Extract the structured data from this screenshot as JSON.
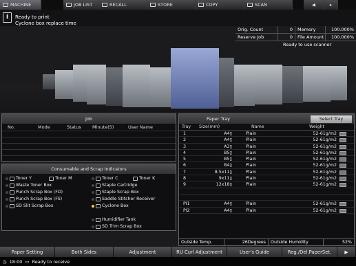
{
  "tabs": [
    {
      "label": "MACHINE",
      "icon": "machine-icon"
    },
    {
      "label": "JOB LIST",
      "icon": "list-icon"
    },
    {
      "label": "RECALL",
      "icon": "recall-icon"
    },
    {
      "label": "STORE",
      "icon": "store-icon"
    },
    {
      "label": "COPY",
      "icon": "copy-icon"
    },
    {
      "label": "SCAN",
      "icon": "scan-icon"
    }
  ],
  "message": {
    "line1": "Ready to print",
    "line2": "Cyclone box replace time"
  },
  "counters": {
    "orig_count_label": "Orig. Count",
    "orig_count_value": "0",
    "memory_label": "Memory",
    "memory_value": "100.000%",
    "reserve_job_label": "Reserve Job",
    "reserve_job_value": "0",
    "file_amount_label": "File Amount",
    "file_amount_value": "100.000%"
  },
  "ready_scanner": "Ready to use scanner",
  "job": {
    "title": "Job",
    "columns": [
      "No.",
      "Mode",
      "Status",
      "Minute(S)",
      "User Name"
    ]
  },
  "consumables": {
    "title": "Consumable and Scrap Indicators",
    "items": [
      {
        "label": "Toner Y"
      },
      {
        "label": "Toner M"
      },
      {
        "label": "Toner C"
      },
      {
        "label": "Toner K"
      },
      {
        "label": "Waste Toner Box"
      },
      {
        "label": "Staple Cartridge"
      },
      {
        "label": "Punch Scrap Box (FD)"
      },
      {
        "label": "Staple Scrap Box"
      },
      {
        "label": "Punch Scrap Box (FS)"
      },
      {
        "label": "Saddle Stitcher Receiver"
      },
      {
        "label": "SD Slit Scrap Box"
      },
      {
        "label": "Cyclone Box"
      },
      {
        "label": "Humidifier Tank"
      },
      {
        "label": "SD Trim Scrap Box"
      }
    ]
  },
  "tray": {
    "title": "Paper Tray",
    "select_label": "Select Tray",
    "columns": [
      "Tray",
      "Size(mm)",
      "Name",
      "Weight"
    ],
    "rows": [
      {
        "tray": "1",
        "size": "A4▯",
        "name": "Plain",
        "weight": "52-61g/m2"
      },
      {
        "tray": "2",
        "size": "A4▯",
        "name": "Plain",
        "weight": "52-61g/m2"
      },
      {
        "tray": "3",
        "size": "A3▯",
        "name": "Plain",
        "weight": "52-61g/m2"
      },
      {
        "tray": "4",
        "size": "B5▯",
        "name": "Plain",
        "weight": "52-61g/m2"
      },
      {
        "tray": "5",
        "size": "B5▯",
        "name": "Plain",
        "weight": "52-61g/m2"
      },
      {
        "tray": "6",
        "size": "B4▯",
        "name": "Plain",
        "weight": "52-61g/m2"
      },
      {
        "tray": "7",
        "size": "8.5x11▯",
        "name": "Plain",
        "weight": "52-61g/m2"
      },
      {
        "tray": "8",
        "size": "9x11▯",
        "name": "Plain",
        "weight": "52-61g/m2"
      },
      {
        "tray": "9",
        "size": "12x18▯",
        "name": "Plain",
        "weight": "52-61g/m2"
      },
      {
        "tray": "PI1",
        "size": "A4▯",
        "name": "Plain",
        "weight": "52-61g/m2"
      },
      {
        "tray": "PI2",
        "size": "A4▯",
        "name": "Plain",
        "weight": "52-61g/m2"
      }
    ],
    "outside_temp_label": "Outside Temp.",
    "outside_temp_value": "26Degrees",
    "outside_humidity_label": "Outside Humidity",
    "outside_humidity_value": "52%"
  },
  "buttons": [
    "Paper Setting",
    "Both Sides",
    "Adjustment",
    "RU Curl Adjustment",
    "User's Guide",
    "Reg./Del.PaperSet."
  ],
  "status": {
    "time": "18:00",
    "text": "Ready to receive"
  },
  "colors": {
    "accent": "#f3d12e",
    "panel": "#0f0f11",
    "header": "#4c4c50"
  }
}
